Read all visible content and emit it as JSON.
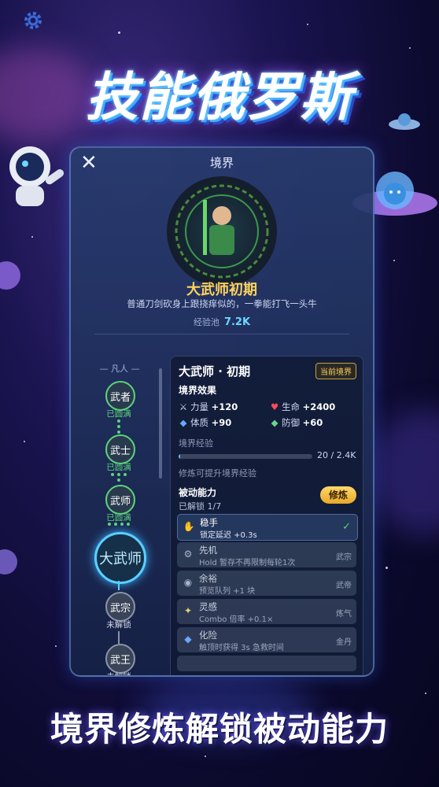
{
  "banner": {
    "title": "技能俄罗斯",
    "slogan": "境界修炼解锁被动能力"
  },
  "panel": {
    "title": "境界",
    "realm_name": "大武师初期",
    "description": "普通刀剑砍身上跟挠痒似的，一拳能打飞一头牛",
    "exp_pool_label": "经验池",
    "exp_pool_value": "7.2K"
  },
  "realm_path": {
    "header": "— 凡人 —",
    "nodes": [
      {
        "label": "武者",
        "status": "已圆满"
      },
      {
        "label": "武士",
        "status": "已圆满"
      },
      {
        "label": "武师",
        "status": "已圆满"
      },
      {
        "label": "大武师",
        "status": ""
      },
      {
        "label": "武宗",
        "status": "未解锁"
      },
      {
        "label": "武王",
        "status": "未解锁"
      }
    ]
  },
  "detail": {
    "name": "大武师 · 初期",
    "current_badge": "当前境界",
    "effects_title": "境界效果",
    "stats": [
      {
        "icon": "swords-icon",
        "label": "力量",
        "value": "+120"
      },
      {
        "icon": "heart-icon",
        "label": "生命",
        "value": "+2400"
      },
      {
        "icon": "shield-icon",
        "label": "体质",
        "value": "+90"
      },
      {
        "icon": "defense-shield-icon",
        "label": "防御",
        "value": "+60"
      }
    ],
    "exp_title": "境界经验",
    "exp_value": "20 / 2.4K",
    "exp_fraction": 0.008,
    "exp_hint": "修炼可提升境界经验",
    "passive_title": "被动能力",
    "passive_unlocked": "已解锁 1/7",
    "train_button": "修炼",
    "skills": [
      {
        "icon": "hand-icon",
        "name": "稳手",
        "desc": "锁定延迟 +0.3s",
        "tag": "",
        "active": true
      },
      {
        "icon": "gear-icon",
        "name": "先机",
        "desc": "Hold 暂存不再限制每轮1次",
        "tag": "武宗",
        "active": false
      },
      {
        "icon": "eye-icon",
        "name": "余裕",
        "desc": "预览队列 +1 块",
        "tag": "武帝",
        "active": false
      },
      {
        "icon": "sparkle-icon",
        "name": "灵感",
        "desc": "Combo 倍率 +0.1×",
        "tag": "炼气",
        "active": false
      },
      {
        "icon": "shield-icon",
        "name": "化险",
        "desc": "触顶时获得 3s 急救时间",
        "tag": "金丹",
        "active": false
      }
    ]
  },
  "colors": {
    "accent_gold": "#ffd35a",
    "accent_cyan": "#5ad0ff",
    "complete_green": "#5bd47a"
  }
}
